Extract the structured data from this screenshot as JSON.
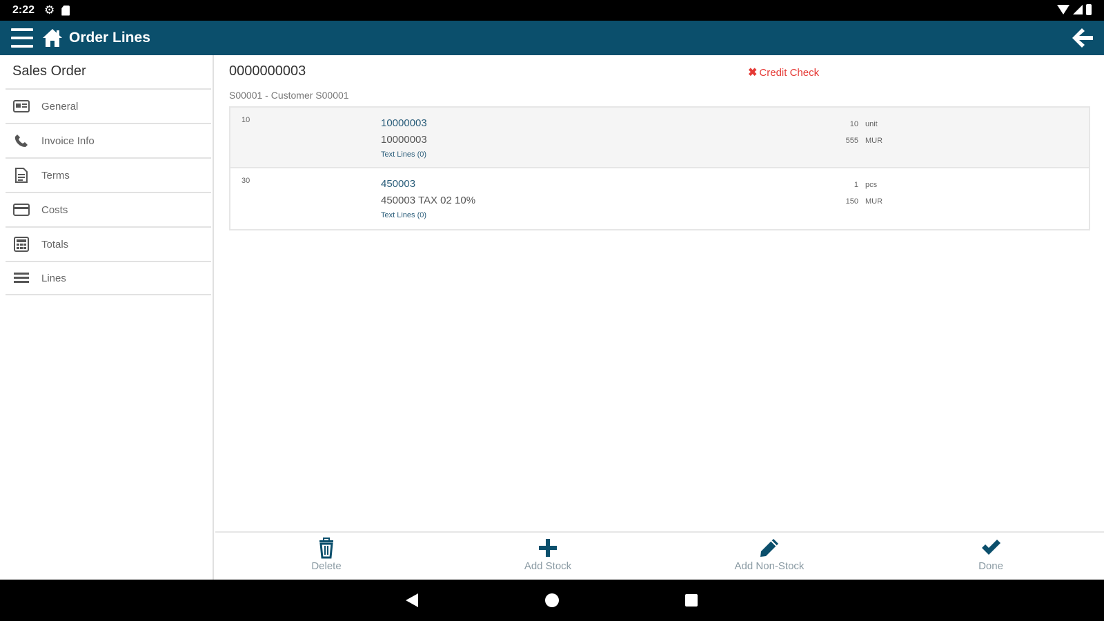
{
  "status_bar": {
    "time": "2:22",
    "gear_icon": "gear-icon",
    "sd_icon": "sd-card-icon"
  },
  "app_bar": {
    "title": "Order Lines",
    "menu_icon": "menu-icon",
    "home_icon": "home-icon",
    "back_icon": "back-arrow-icon",
    "bg_color": "#0b4f6c"
  },
  "sidebar": {
    "title": "Sales Order",
    "items": [
      {
        "label": "General",
        "icon": "id-card-icon"
      },
      {
        "label": "Invoice Info",
        "icon": "phone-icon"
      },
      {
        "label": "Terms",
        "icon": "document-icon"
      },
      {
        "label": "Costs",
        "icon": "credit-card-icon"
      },
      {
        "label": "Totals",
        "icon": "calculator-icon"
      },
      {
        "label": "Lines",
        "icon": "list-icon"
      }
    ]
  },
  "order": {
    "number": "0000000003",
    "customer": "S00001 - Customer S00001",
    "credit_check": "Credit Check",
    "credit_check_color": "#e53935"
  },
  "lines": [
    {
      "line_no": "10",
      "item": "10000003",
      "description": "10000003",
      "text_lines": "Text Lines (0)",
      "qty": "10",
      "unit": "unit",
      "price": "555",
      "currency": "MUR"
    },
    {
      "line_no": "30",
      "item": "450003",
      "description": "450003 TAX 02 10%",
      "text_lines": "Text Lines (0)",
      "qty": "1",
      "unit": "pcs",
      "price": "150",
      "currency": "MUR"
    }
  ],
  "toolbar": {
    "delete_label": "Delete",
    "add_stock_label": "Add Stock",
    "add_non_stock_label": "Add Non-Stock",
    "done_label": "Done",
    "icon_color": "#0b4f6c"
  }
}
